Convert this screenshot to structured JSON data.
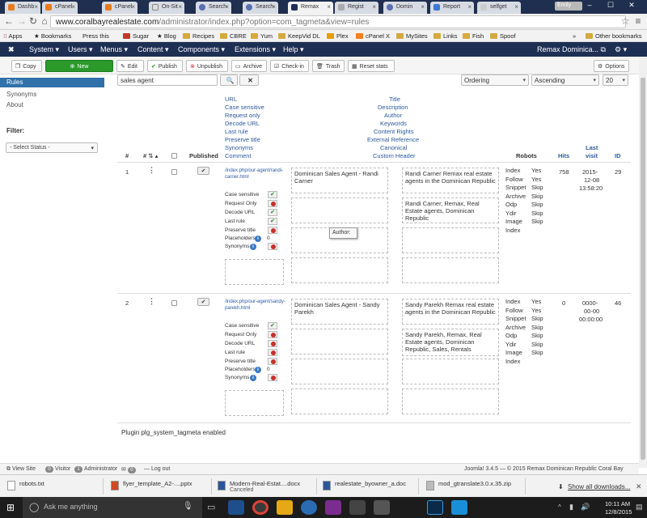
{
  "browser": {
    "tabs": [
      {
        "label": "Dashb",
        "active": false
      },
      {
        "label": "cPanel",
        "active": false
      },
      {
        "label": "cPanel",
        "active": false
      },
      {
        "label": "On-Sit",
        "active": false
      },
      {
        "label": "Search",
        "active": false
      },
      {
        "label": "Search",
        "active": false
      },
      {
        "label": "Remax",
        "active": true
      },
      {
        "label": "Regist",
        "active": false
      },
      {
        "label": "Domin",
        "active": false
      },
      {
        "label": "Report",
        "active": false
      },
      {
        "label": "selfget",
        "active": false
      }
    ],
    "window_user": "Emily",
    "url_host": "www.coralbayrealestate.com",
    "url_path": "/administrator/index.php?option=com_tagmeta&view=rules",
    "bookmarks": [
      "Apps",
      "Bookmarks",
      "Press this",
      "Sugar",
      "Blog",
      "Recipes",
      "CBRE",
      "Yum",
      "KeepVid DL",
      "Plex",
      "cPanel X",
      "MySites",
      "Links",
      "Fish",
      "Spoof"
    ],
    "bookmarks_more": "»",
    "other_bookmarks": "Other bookmarks"
  },
  "joomla_nav": {
    "menus": [
      "System",
      "Users",
      "Menus",
      "Content",
      "Components",
      "Extensions",
      "Help"
    ],
    "site_name": "Remax Dominica...",
    "gear": "⚙"
  },
  "toolbar": {
    "copy": "Copy",
    "new": "New",
    "edit": "Edit",
    "publish": "Publish",
    "unpublish": "Unpublish",
    "archive": "Archive",
    "checkin": "Check-in",
    "trash": "Trash",
    "reset": "Reset stats",
    "options": "Options"
  },
  "sidebar": {
    "items": [
      "Rules",
      "Synonyms",
      "About"
    ],
    "filter_label": "Filter:",
    "status_select": "- Select Status -"
  },
  "filters": {
    "search_value": "sales agent",
    "ordering": "Ordering",
    "direction": "Ascending",
    "limit": "20"
  },
  "table": {
    "headers": {
      "num": "#",
      "sort": "#",
      "published": "Published",
      "robots": "Robots",
      "hits": "Hits",
      "last_visit_1": "Last",
      "last_visit_2": "visit",
      "id": "ID"
    },
    "url_col": [
      "URL",
      "Case sensitive",
      "Request only",
      "Decode URL",
      "Last rule",
      "Preserve title",
      "Synonyms",
      "Comment"
    ],
    "title_col": [
      "Title",
      "Description",
      "Author",
      "Keywords",
      "Content Rights",
      "External Reference",
      "Canonical",
      "Custom Header"
    ],
    "option_labels": [
      "Case sensitive",
      "Request Only",
      "Decode URL",
      "Last rule",
      "Preserve title",
      "Placeholders",
      "Synonyms"
    ],
    "placeholders_count": "0",
    "rows": [
      {
        "num": "1",
        "url": "/index.php/our-agent/randi-carner.html",
        "options": [
          "yes",
          "no",
          "yes",
          "yes",
          "no",
          "",
          "no"
        ],
        "title": "Dominican Sales Agent - Randi Carner",
        "description": "Randi Carner Remax real estate agents in the Dominican Republic",
        "keywords": "Randi Carner, Remax, Real Estate agents, Dominican Republic",
        "robots": [
          [
            "Index",
            "Yes"
          ],
          [
            "Follow",
            "Yes"
          ],
          [
            "Snippet",
            "Skip"
          ],
          [
            "Archive",
            "Skip"
          ],
          [
            "Odp",
            "Skip"
          ],
          [
            "Ydir",
            "Skip"
          ],
          [
            "Image",
            "Skip"
          ],
          [
            "Index",
            ""
          ]
        ],
        "hits": "758",
        "last_visit": [
          "2015-",
          "12-08",
          "13:58:20"
        ],
        "id": "29"
      },
      {
        "num": "2",
        "url": "/index.php/our-agent/sandy-parekh.html",
        "options": [
          "yes",
          "no",
          "no",
          "no",
          "no",
          "",
          "no"
        ],
        "title": "Dominican Sales Agent - Sandy Parekh",
        "description": "Sandy Parekh Remax real estate agents in the Dominican Republic",
        "keywords": "Sandy Parekh, Remax, Real Estate agents, Dominican Republic, Sales, Rentals",
        "robots": [
          [
            "Index",
            "Yes"
          ],
          [
            "Follow",
            "Yes"
          ],
          [
            "Snippet",
            "Skip"
          ],
          [
            "Archive",
            "Skip"
          ],
          [
            "Odp",
            "Skip"
          ],
          [
            "Ydir",
            "Skip"
          ],
          [
            "Image",
            "Skip"
          ],
          [
            "Index",
            ""
          ]
        ],
        "hits": "0",
        "last_visit": [
          "0000-",
          "00-00",
          "00:00:00"
        ],
        "id": "46"
      }
    ],
    "tooltip": "Author:"
  },
  "plugin_message": "Plugin plg_system_tagmeta enabled",
  "status_bar": {
    "view_site": "View Site",
    "visitor_count": "0",
    "visitor": "Visitor",
    "admin_count": "1",
    "administrator": "Administrator",
    "messages_count": "0",
    "logout": "Log out",
    "footer": "Joomla! 3.4.5 — © 2015 Remax Dominican Republic Coral Bay"
  },
  "downloads": [
    {
      "name": "robots.txt",
      "sub": ""
    },
    {
      "name": "flyer_template_A2-....pptx",
      "sub": ""
    },
    {
      "name": "Modern-Real-Estat....docx",
      "sub": "Canceled"
    },
    {
      "name": "realestate_byowner_a.doc",
      "sub": ""
    },
    {
      "name": "mod_gtranslate3.0.x.35.zip",
      "sub": ""
    }
  ],
  "show_all_downloads": "Show all downloads...",
  "taskbar": {
    "search_placeholder": "Ask me anything",
    "time": "10:11 AM",
    "date": "12/8/2015"
  }
}
